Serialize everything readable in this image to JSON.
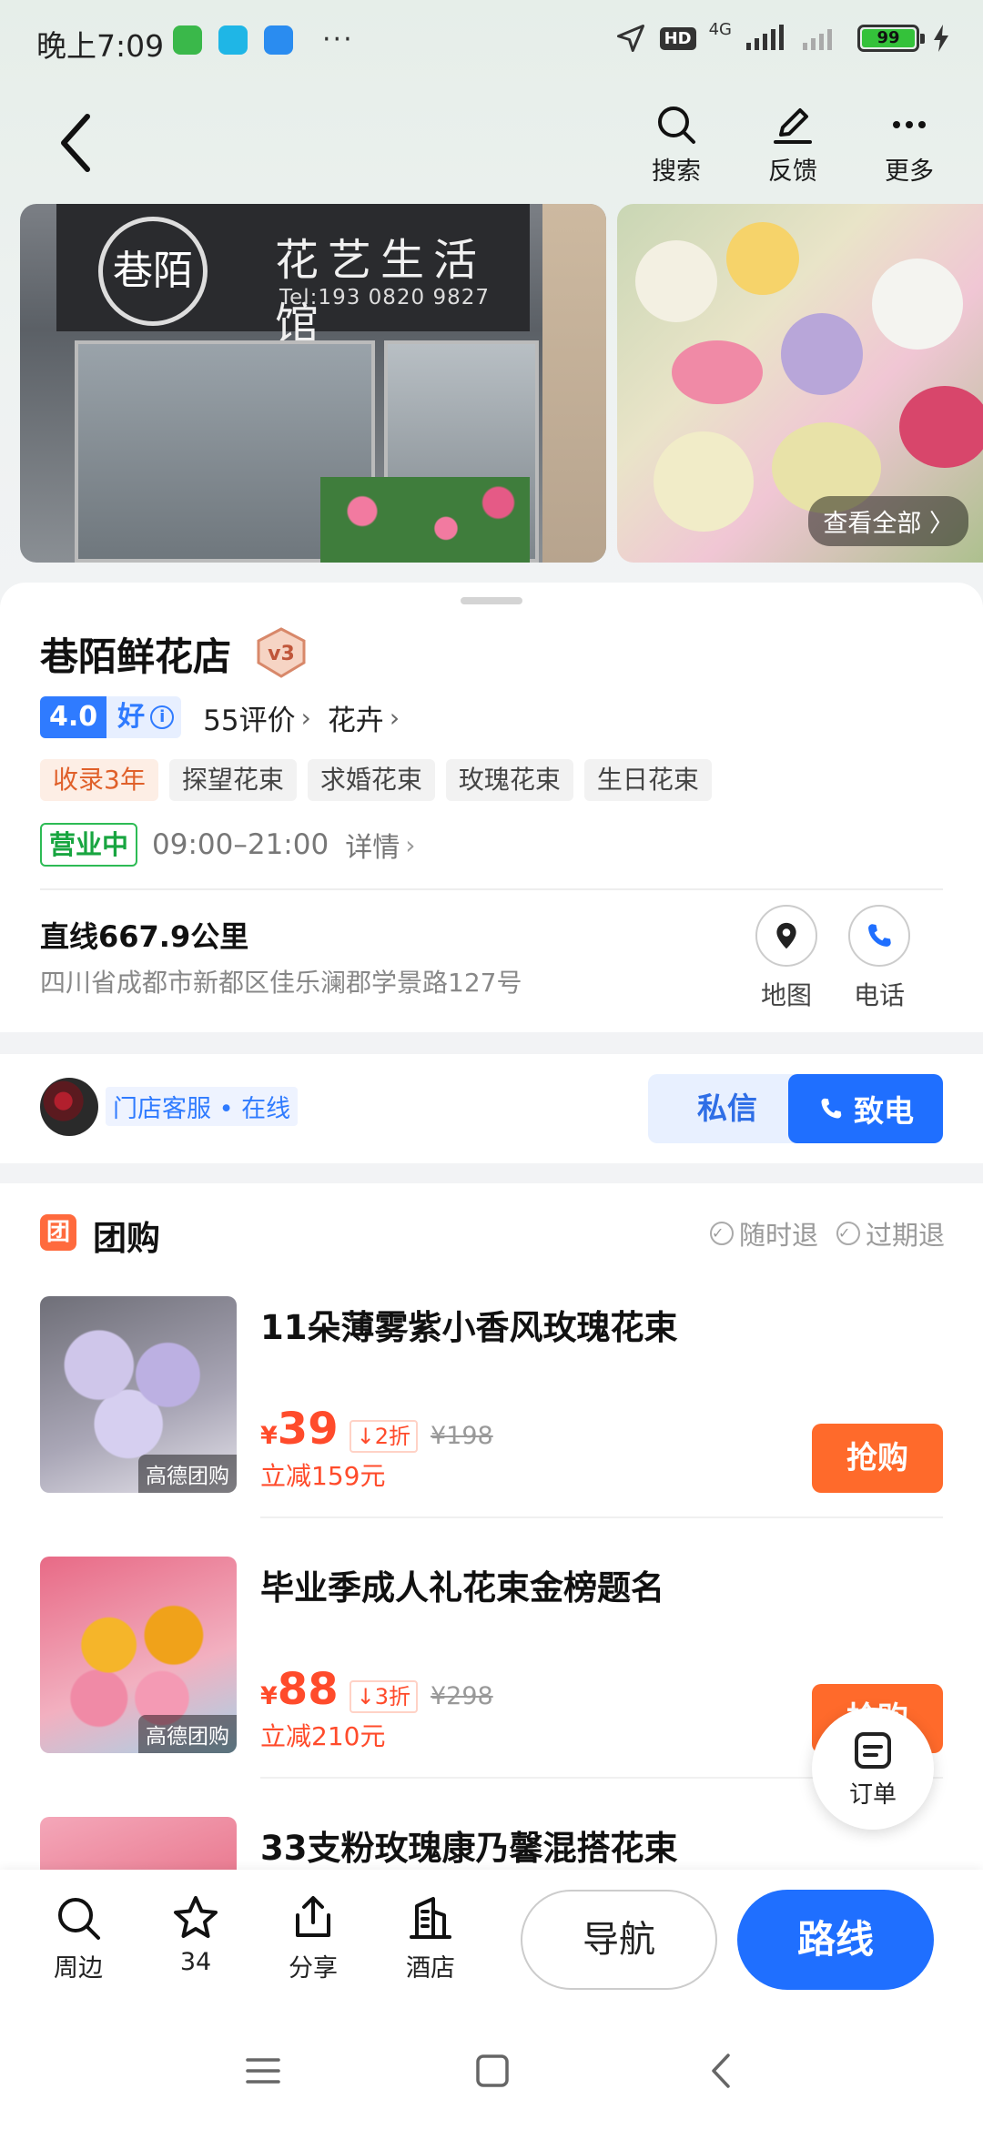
{
  "status_bar": {
    "time": "晚上7:09",
    "more": "···",
    "hd": "HD",
    "network": "4G",
    "battery": "99",
    "app_colors": [
      "#3ab84a",
      "#1fb6e6",
      "#2a8cf0"
    ]
  },
  "header": {
    "actions": [
      {
        "label": "搜索",
        "icon": "search-icon"
      },
      {
        "label": "反馈",
        "icon": "feedback-pen-icon"
      },
      {
        "label": "更多",
        "icon": "more-dots-icon"
      }
    ]
  },
  "photos": {
    "sign_logo": "巷陌",
    "sign_text": "花艺生活馆",
    "sign_tel": "Tel:193 0820 9827",
    "view_all": "查看全部 〉"
  },
  "shop": {
    "name": "巷陌鲜花店",
    "level_badge": "v3",
    "score": "4.0",
    "score_word": "好",
    "info_icon": "i",
    "reviews": "55评价",
    "category": "花卉",
    "tags": [
      "收录3年",
      "探望花束",
      "求婚花束",
      "玫瑰花束",
      "生日花束"
    ],
    "status": "营业中",
    "hours": "09:00–21:00",
    "details": "详情",
    "distance": "直线667.9公里",
    "address": "四川省成都市新都区佳乐澜郡学景路127号",
    "map_label": "地图",
    "phone_label": "电话"
  },
  "service": {
    "label": "门店客服 • 在线",
    "message_btn": "私信",
    "call_btn": "致电"
  },
  "group_buy": {
    "icon_text": "团",
    "title": "团购",
    "guarantees": [
      "随时退",
      "过期退"
    ],
    "deals": [
      {
        "title": "11朵薄雾紫小香风玫瑰花束",
        "yen": "¥",
        "price": "39",
        "discount": "2折",
        "original": "¥198",
        "save": "立减159元",
        "img_label": "高德团购",
        "buy": "抢购"
      },
      {
        "title": "毕业季成人礼花束金榜题名",
        "yen": "¥",
        "price": "88",
        "discount": "3折",
        "original": "¥298",
        "save": "立减210元",
        "img_label": "高德团购",
        "buy": "抢购"
      },
      {
        "title": "33支粉玫瑰康乃馨混搭花束",
        "yen": "",
        "price": "",
        "discount": "",
        "original": "",
        "save": "",
        "img_label": "",
        "buy": ""
      }
    ]
  },
  "order_fab": {
    "label": "订单"
  },
  "bottom_bar": {
    "items": [
      {
        "label": "周边",
        "icon": "search-icon"
      },
      {
        "label": "34",
        "icon": "star-icon"
      },
      {
        "label": "分享",
        "icon": "share-icon"
      },
      {
        "label": "酒店",
        "icon": "hotel-icon"
      }
    ],
    "nav_btn": "导航",
    "route_btn": "路线"
  },
  "colors": {
    "brand_blue": "#1f6fff",
    "deal_orange": "#ff6a2b",
    "price_red": "#ff4b2b",
    "open_green": "#18a540"
  }
}
